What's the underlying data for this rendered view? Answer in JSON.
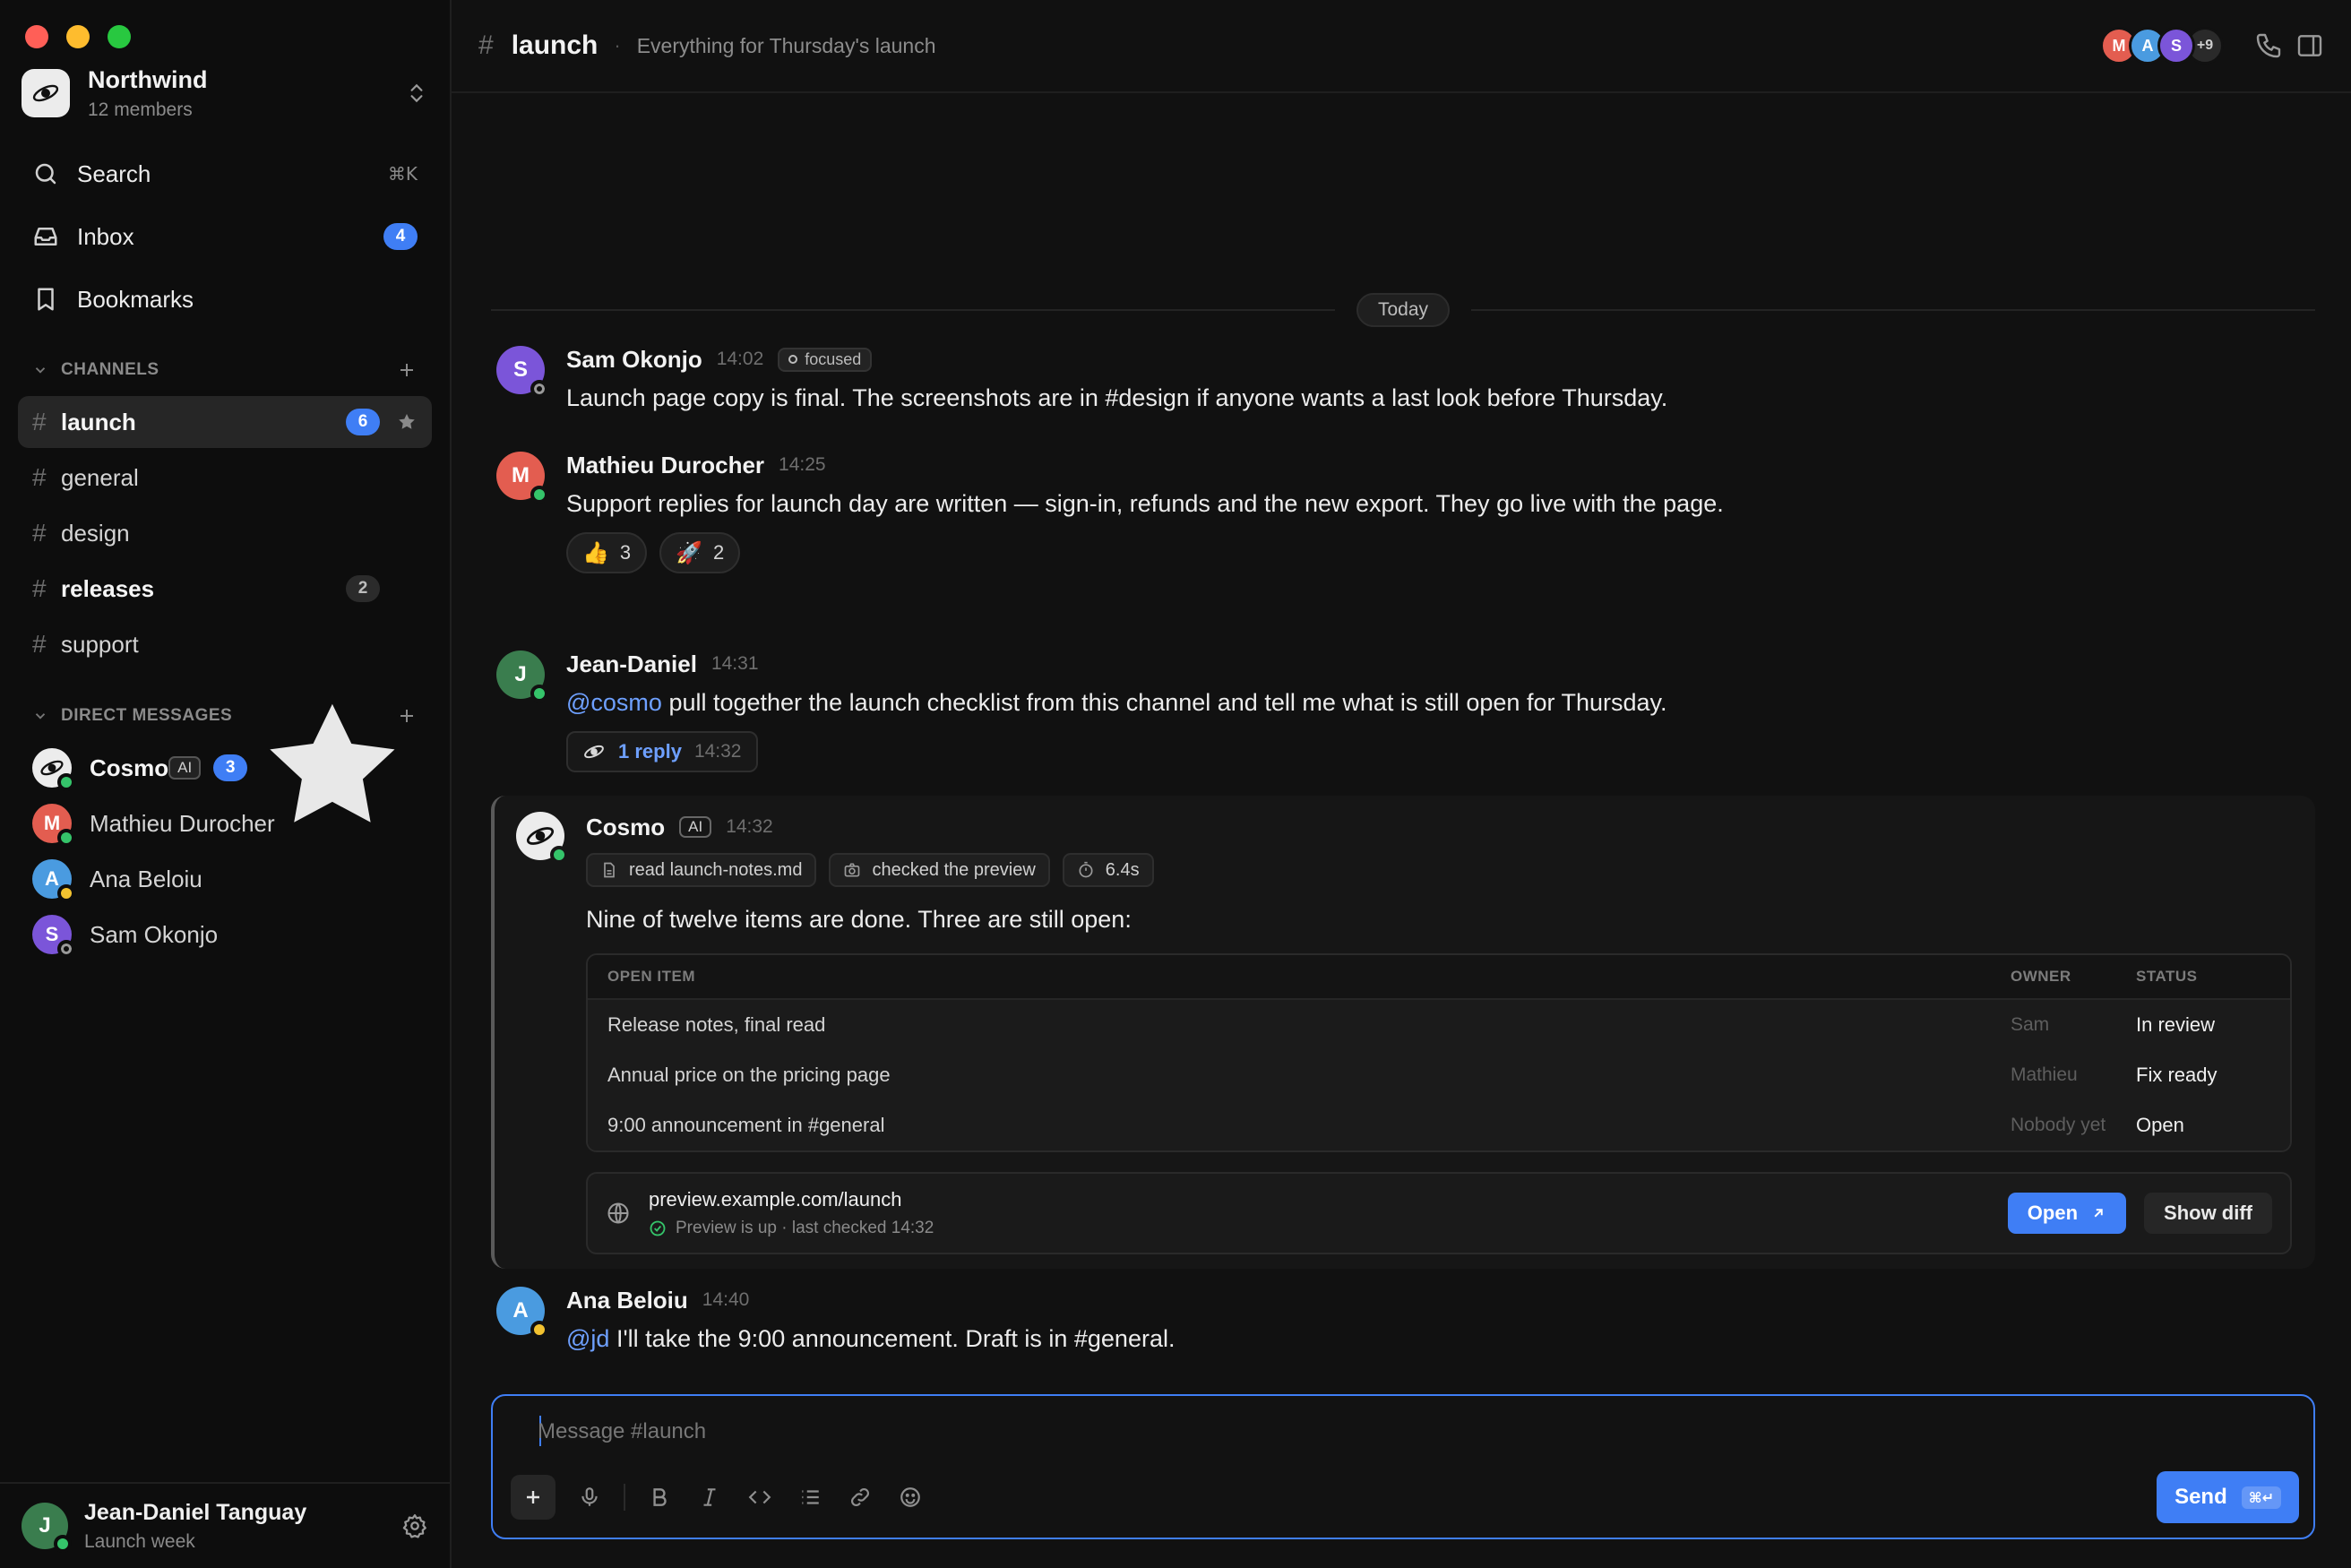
{
  "workspace": {
    "name": "Northwind",
    "members": "12 members"
  },
  "nav": {
    "search": {
      "label": "Search",
      "shortcut": "⌘K"
    },
    "inbox": {
      "label": "Inbox",
      "badge": "4"
    },
    "bookmarks": {
      "label": "Bookmarks"
    }
  },
  "channels_section": {
    "title": "CHANNELS",
    "items": [
      {
        "name": "launch",
        "badge": "6"
      },
      {
        "name": "general"
      },
      {
        "name": "design"
      },
      {
        "name": "releases",
        "badge": "2"
      },
      {
        "name": "support"
      }
    ]
  },
  "dm_section": {
    "title": "DIRECT MESSAGES",
    "items": [
      {
        "name": "Cosmo",
        "tag": "AI",
        "badge": "3"
      },
      {
        "name": "Mathieu Durocher",
        "initial": "M"
      },
      {
        "name": "Ana Beloiu",
        "initial": "A"
      },
      {
        "name": "Sam Okonjo",
        "initial": "S"
      }
    ]
  },
  "current_user": {
    "name": "Jean-Daniel Tanguay",
    "status": "Launch week",
    "initial": "J"
  },
  "header": {
    "channel": "launch",
    "topic": "Everything for Thursday's launch",
    "members": [
      "M",
      "A",
      "S"
    ],
    "more": "+9"
  },
  "day_divider": "Today",
  "messages": [
    {
      "author": "Sam Okonjo",
      "initial": "S",
      "time": "14:02",
      "status": "focused",
      "text": "Launch page copy is final. The screenshots are in #design if anyone wants a last look before Thursday."
    },
    {
      "author": "Mathieu Durocher",
      "initial": "M",
      "time": "14:25",
      "text": "Support replies for launch day are written — sign-in, refunds and the new export. They go live with the page.",
      "reactions": [
        {
          "emoji": "👍",
          "count": "3"
        },
        {
          "emoji": "🚀",
          "count": "2"
        }
      ]
    },
    {
      "author": "Jean-Daniel",
      "initial": "J",
      "time": "14:31",
      "mention": "@cosmo",
      "text": " pull together the launch checklist from this channel and tell me what is still open for Thursday.",
      "thread": {
        "label": "1 reply",
        "time": "14:32"
      }
    },
    {
      "author": "Ana Beloiu",
      "initial": "A",
      "time": "14:40",
      "mention": "@jd",
      "text": " I'll take the 9:00 announcement. Draft is in #general."
    }
  ],
  "cosmo": {
    "author": "Cosmo",
    "tag": "AI",
    "time": "14:32",
    "tools": [
      "read launch-notes.md",
      "checked the preview",
      "6.4s"
    ],
    "text": "Nine of twelve items are done. Three are still open:",
    "table": {
      "headers": [
        "OPEN ITEM",
        "OWNER",
        "STATUS"
      ],
      "rows": [
        [
          "Release notes, final read",
          "Sam",
          "In review"
        ],
        [
          "Annual price on the pricing page",
          "Mathieu",
          "Fix ready"
        ],
        [
          "9:00 announcement in #general",
          "Nobody yet",
          "Open"
        ]
      ]
    },
    "preview": {
      "url": "preview.example.com/launch",
      "status": "Preview is up · last checked 14:32",
      "open_label": "Open",
      "diff_label": "Show diff"
    }
  },
  "composer": {
    "placeholder": "Message #launch",
    "send_label": "Send",
    "send_shortcut": "⌘↵"
  },
  "colors": {
    "accent": "#3f7ef5",
    "online": "#35c46a",
    "away": "#f2c230"
  }
}
